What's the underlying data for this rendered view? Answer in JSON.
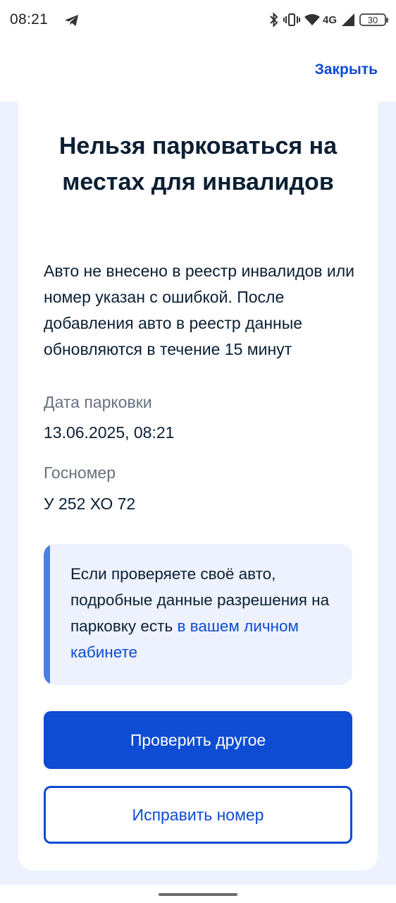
{
  "status_bar": {
    "time": "08:21",
    "network": "4G",
    "battery": "30"
  },
  "header": {
    "close_label": "Закрыть"
  },
  "card": {
    "title": "Нельзя парковаться на местах для инвалидов",
    "description": "Авто не внесено в реестр инвалидов или номер указан с ошибкой. После добавления авто в реестр данные обновляются в течение 15 минут",
    "fields": [
      {
        "label": "Дата парковки",
        "value": "13.06.2025, 08:21"
      },
      {
        "label": "Госномер",
        "value": "У 252 ХО 72"
      }
    ],
    "info": {
      "text": "Если проверяете своё авто, подробные данные разрешения на парковку есть",
      "link": "в вашем личном кабинете"
    },
    "primary_button": "Проверить другое",
    "secondary_button": "Исправить номер"
  },
  "colors": {
    "accent": "#0d4cd3",
    "background": "#edf2fe",
    "text": "#0b1f33",
    "muted": "#66727f"
  }
}
